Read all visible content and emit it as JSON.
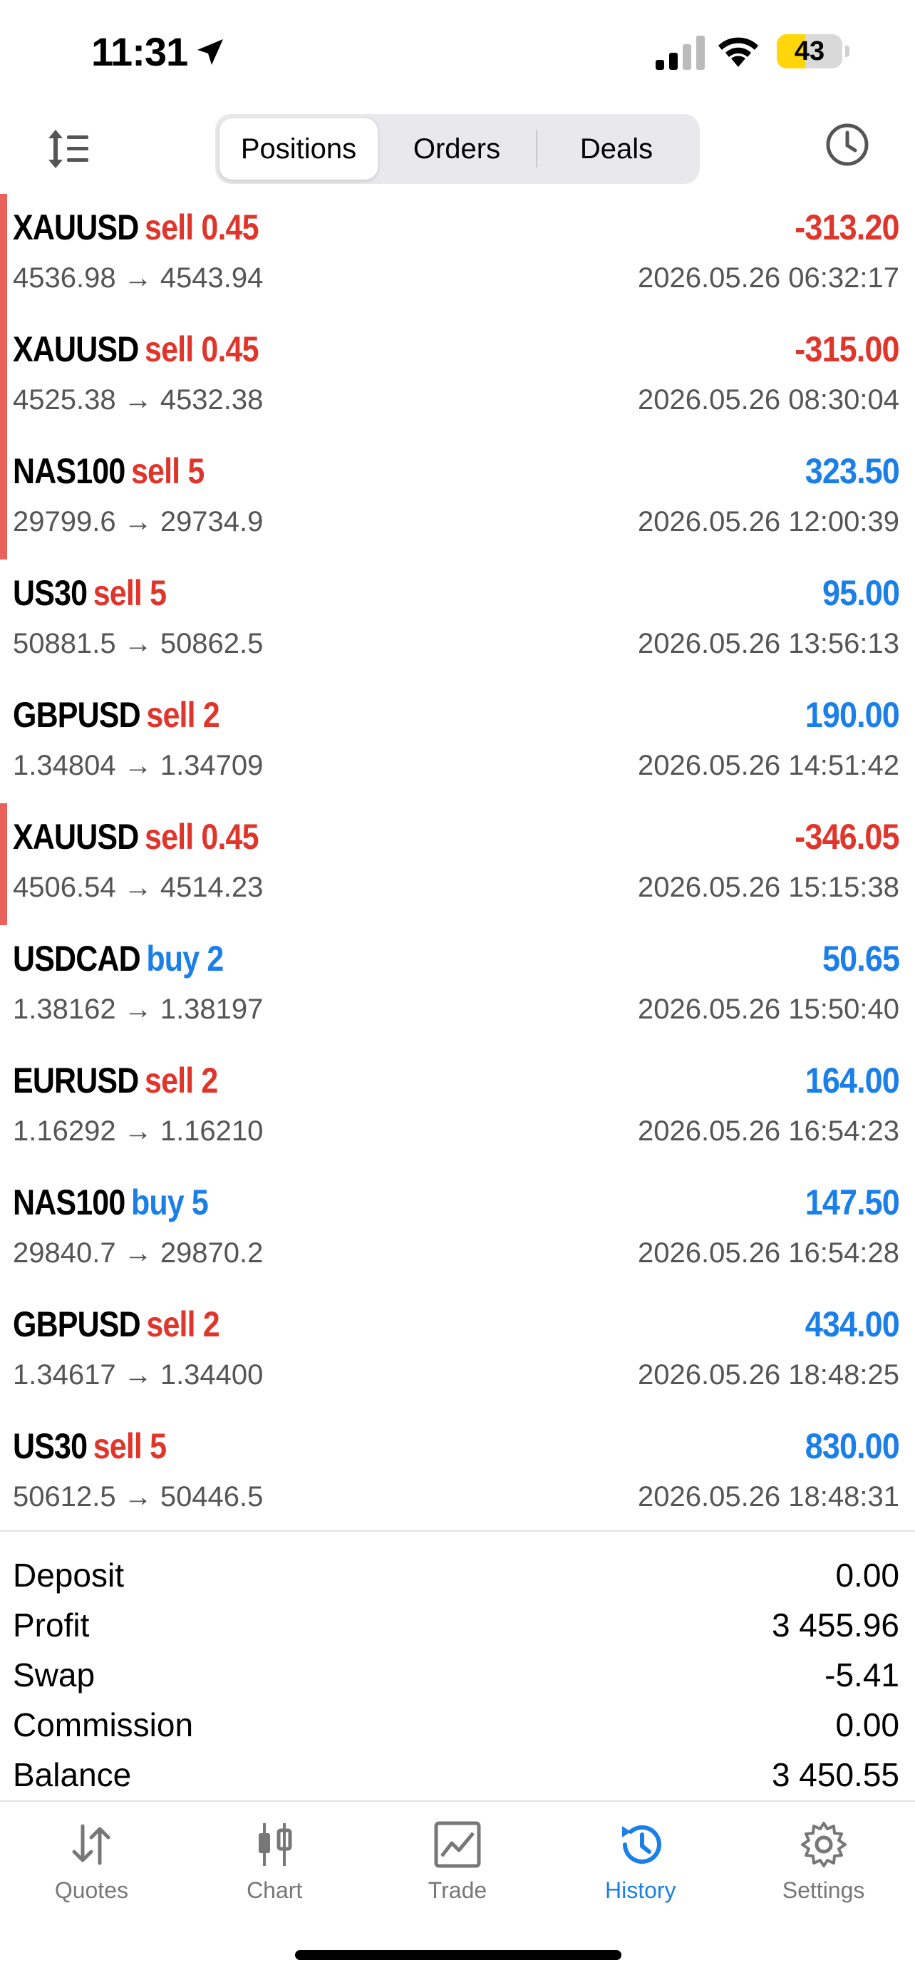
{
  "status_bar": {
    "time": "11:31",
    "battery": "43",
    "battery_level": 0.43
  },
  "toolbar": {
    "tabs": [
      {
        "label": "Positions",
        "active": true
      },
      {
        "label": "Orders",
        "active": false
      },
      {
        "label": "Deals",
        "active": false
      }
    ],
    "icons": [
      "sort-icon",
      "clock-icon"
    ]
  },
  "rows": [
    {
      "symbol": "XAUUSD",
      "side": "sell 0.45",
      "side_type": "sell",
      "prices": "4536.98 → 4543.94",
      "profit": "-313.20",
      "profit_type": "loss",
      "date": "2026.05.26 06:32:17",
      "marker": true
    },
    {
      "symbol": "XAUUSD",
      "side": "sell 0.45",
      "side_type": "sell",
      "prices": "4525.38 → 4532.38",
      "profit": "-315.00",
      "profit_type": "loss",
      "date": "2026.05.26 08:30:04",
      "marker": true
    },
    {
      "symbol": "NAS100",
      "side": "sell 5",
      "side_type": "sell",
      "prices": "29799.6 → 29734.9",
      "profit": "323.50",
      "profit_type": "gain",
      "date": "2026.05.26 12:00:39",
      "marker": true
    },
    {
      "symbol": "US30",
      "side": "sell 5",
      "side_type": "sell",
      "prices": "50881.5 → 50862.5",
      "profit": "95.00",
      "profit_type": "gain",
      "date": "2026.05.26 13:56:13",
      "marker": false
    },
    {
      "symbol": "GBPUSD",
      "side": "sell 2",
      "side_type": "sell",
      "prices": "1.34804 → 1.34709",
      "profit": "190.00",
      "profit_type": "gain",
      "date": "2026.05.26 14:51:42",
      "marker": false
    },
    {
      "symbol": "XAUUSD",
      "side": "sell 0.45",
      "side_type": "sell",
      "prices": "4506.54 → 4514.23",
      "profit": "-346.05",
      "profit_type": "loss",
      "date": "2026.05.26 15:15:38",
      "marker": true
    },
    {
      "symbol": "USDCAD",
      "side": "buy 2",
      "side_type": "buy",
      "prices": "1.38162 → 1.38197",
      "profit": "50.65",
      "profit_type": "gain",
      "date": "2026.05.26 15:50:40",
      "marker": false
    },
    {
      "symbol": "EURUSD",
      "side": "sell 2",
      "side_type": "sell",
      "prices": "1.16292 → 1.16210",
      "profit": "164.00",
      "profit_type": "gain",
      "date": "2026.05.26 16:54:23",
      "marker": false
    },
    {
      "symbol": "NAS100",
      "side": "buy 5",
      "side_type": "buy",
      "prices": "29840.7 → 29870.2",
      "profit": "147.50",
      "profit_type": "gain",
      "date": "2026.05.26 16:54:28",
      "marker": false
    },
    {
      "symbol": "GBPUSD",
      "side": "sell 2",
      "side_type": "sell",
      "prices": "1.34617 → 1.34400",
      "profit": "434.00",
      "profit_type": "gain",
      "date": "2026.05.26 18:48:25",
      "marker": false
    },
    {
      "symbol": "US30",
      "side": "sell 5",
      "side_type": "sell",
      "prices": "50612.5 → 50446.5",
      "profit": "830.00",
      "profit_type": "gain",
      "date": "2026.05.26 18:48:31",
      "marker": false
    }
  ],
  "summary": [
    {
      "label": "Deposit",
      "value": "0.00"
    },
    {
      "label": "Profit",
      "value": "3 455.96"
    },
    {
      "label": "Swap",
      "value": "-5.41"
    },
    {
      "label": "Commission",
      "value": "0.00"
    },
    {
      "label": "Balance",
      "value": "3 450.55"
    }
  ],
  "tabbar": [
    {
      "label": "Quotes",
      "icon": "quotes-icon",
      "active": false
    },
    {
      "label": "Chart",
      "icon": "chart-icon",
      "active": false
    },
    {
      "label": "Trade",
      "icon": "trade-icon",
      "active": false
    },
    {
      "label": "History",
      "icon": "history-icon",
      "active": true
    },
    {
      "label": "Settings",
      "icon": "settings-icon",
      "active": false
    }
  ],
  "colors": {
    "sell": "#e0352b",
    "buy": "#1a7fe8",
    "gain": "#1a7fe8",
    "loss": "#e0352b",
    "marker": "#e8615a",
    "accent": "#1a7fe8",
    "battery": "#ffd60a"
  }
}
